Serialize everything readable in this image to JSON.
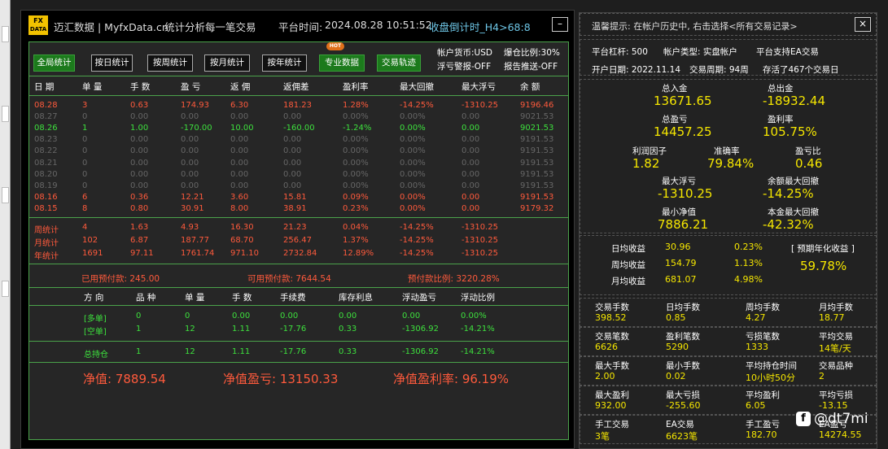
{
  "title": {
    "logo_top": "FX",
    "logo_bottom": "DATA",
    "brand": "迈汇数据 | MyfxData.cn",
    "subtitle": "统计分析每一笔交易",
    "time_label": "平台时间:",
    "time_value": "2024.08.28 10:51:52",
    "countdown": "收盘倒计时_H4>68:8",
    "minimize": "–"
  },
  "buttons": [
    "全局统计",
    "按日统计",
    "按周统计",
    "按月统计",
    "按年统计",
    "专业数据",
    "交易轨迹"
  ],
  "hot_badge": "HOT",
  "account_info": {
    "currency": "帐户货币:USD",
    "leverage_ratio": "爆仓比例:30%",
    "float_alert": "浮亏警报-OFF",
    "report_push": "报告推送-OFF"
  },
  "table_headers": [
    "日 期",
    "单 量",
    "手 数",
    "盈 亏",
    "返 佣",
    "返佣差",
    "盈利率",
    "最大回撤",
    "最大浮亏",
    "余 额"
  ],
  "daily_rows": [
    {
      "c": "red",
      "v": [
        "08.28",
        "3",
        "0.63",
        "174.93",
        "6.30",
        "181.23",
        "1.28%",
        "-14.25%",
        "-1310.25",
        "9196.46"
      ]
    },
    {
      "c": "gry",
      "v": [
        "08.27",
        "0",
        "0.00",
        "0.00",
        "0.00",
        "0.00",
        "0.00%",
        "0.00%",
        "0.00",
        "9021.53"
      ]
    },
    {
      "c": "grn",
      "v": [
        "08.26",
        "1",
        "1.00",
        "-170.00",
        "10.00",
        "-160.00",
        "-1.24%",
        "0.00%",
        "0.00",
        "9021.53"
      ]
    },
    {
      "c": "gry",
      "v": [
        "08.23",
        "0",
        "0.00",
        "0.00",
        "0.00",
        "0.00",
        "0.00%",
        "0.00%",
        "0.00",
        "9191.53"
      ]
    },
    {
      "c": "gry",
      "v": [
        "08.22",
        "0",
        "0.00",
        "0.00",
        "0.00",
        "0.00",
        "0.00%",
        "0.00%",
        "0.00",
        "9191.53"
      ]
    },
    {
      "c": "gry",
      "v": [
        "08.21",
        "0",
        "0.00",
        "0.00",
        "0.00",
        "0.00",
        "0.00%",
        "0.00%",
        "0.00",
        "9191.53"
      ]
    },
    {
      "c": "gry",
      "v": [
        "08.20",
        "0",
        "0.00",
        "0.00",
        "0.00",
        "0.00",
        "0.00%",
        "0.00%",
        "0.00",
        "9191.53"
      ]
    },
    {
      "c": "gry",
      "v": [
        "08.19",
        "0",
        "0.00",
        "0.00",
        "0.00",
        "0.00",
        "0.00%",
        "0.00%",
        "0.00",
        "9191.53"
      ]
    },
    {
      "c": "red",
      "v": [
        "08.16",
        "6",
        "0.36",
        "12.21",
        "3.60",
        "15.81",
        "0.09%",
        "0.00%",
        "0.00",
        "9191.53"
      ]
    },
    {
      "c": "red",
      "v": [
        "08.15",
        "8",
        "0.80",
        "30.91",
        "8.00",
        "38.91",
        "0.23%",
        "0.00%",
        "0.00",
        "9179.32"
      ]
    }
  ],
  "period_rows": [
    {
      "c": "red",
      "v": [
        "周统计",
        "4",
        "1.63",
        "4.93",
        "16.30",
        "21.23",
        "0.04%",
        "-14.25%",
        "-1310.25"
      ]
    },
    {
      "c": "red",
      "v": [
        "月统计",
        "102",
        "6.87",
        "187.77",
        "68.70",
        "256.47",
        "1.37%",
        "-14.25%",
        "-1310.25"
      ]
    },
    {
      "c": "red",
      "v": [
        "年统计",
        "1691",
        "97.11",
        "1761.74",
        "971.10",
        "2732.84",
        "12.89%",
        "-14.25%",
        "-1310.25"
      ]
    }
  ],
  "margin": {
    "used": "已用预付款:  245.00",
    "free": "可用预付款:  7644.54",
    "ratio": "预付款比例:  3220.28%"
  },
  "pos_headers": [
    "方 向",
    "品 种",
    "单 量",
    "手 数",
    "手续费",
    "库存利息",
    "浮动盈亏",
    "浮动比例"
  ],
  "pos_rows": [
    {
      "c": "grn",
      "v": [
        "[多单]",
        "0",
        "0",
        "0.00",
        "0.00",
        "0.00",
        "0.00",
        "0.00%"
      ]
    },
    {
      "c": "grn",
      "v": [
        "[空单]",
        "1",
        "12",
        "1.11",
        "-17.76",
        "0.33",
        "-1306.92",
        "-14.21%"
      ]
    }
  ],
  "total_row": {
    "c": "grn",
    "v": [
      "总持仓",
      "1",
      "12",
      "1.11",
      "-17.76",
      "0.33",
      "-1306.92",
      "-14.21%"
    ]
  },
  "equity": {
    "net": "净值:  7889.54",
    "net_pl": "净值盈亏:  13150.33",
    "net_rate": "净值盈利率:  96.19%"
  },
  "right": {
    "tip": "温馨提示: 在帐户历史中, 右击选择<所有交易记录>",
    "close": "×",
    "row1": [
      "平台杠杆:  500",
      "帐户类型:  实盘帐户",
      "平台支持EA交易"
    ],
    "row2": [
      "开户日期:  2022.11.14",
      "交易周期:  94周",
      "存活了467个交易日"
    ],
    "pairs": [
      {
        "l1": "总入金",
        "v1": "13671.65",
        "l2": "总出金",
        "v2": "-18932.44"
      },
      {
        "l1": "总盈亏",
        "v1": "14457.25",
        "l2": "盈利率",
        "v2": "105.75%"
      }
    ],
    "triple": {
      "labels": [
        "利润因子",
        "准确率",
        "盈亏比"
      ],
      "values": [
        "1.82",
        "79.84%",
        "0.46"
      ]
    },
    "pairs2": [
      {
        "l1": "最大浮亏",
        "v1": "-1310.25",
        "l2": "余额最大回撤",
        "v2": "-14.25%"
      },
      {
        "l1": "最小净值",
        "v1": "7886.21",
        "l2": "本金最大回撤",
        "v2": "-42.32%"
      }
    ],
    "avg": {
      "rows": [
        [
          "日均收益",
          "30.96",
          "0.23%"
        ],
        [
          "周均收益",
          "154.79",
          "1.13%"
        ],
        [
          "月均收益",
          "681.07",
          "4.98%"
        ]
      ],
      "forecast_label": "[ 预期年化收益 ]",
      "forecast_value": "59.78%"
    },
    "grid": [
      [
        [
          "交易手数",
          "398.52"
        ],
        [
          "日均手数",
          "0.85"
        ],
        [
          "周均手数",
          "4.27"
        ],
        [
          "月均手数",
          "18.77"
        ]
      ],
      [
        [
          "交易笔数",
          "6626"
        ],
        [
          "盈利笔数",
          "5290"
        ],
        [
          "亏损笔数",
          "1333"
        ],
        [
          "平均交易",
          "14笔/天"
        ]
      ],
      [
        [
          "最大手数",
          "2.00"
        ],
        [
          "最小手数",
          "0.02"
        ],
        [
          "平均持仓时间",
          "10小时50分"
        ],
        [
          "交易品种",
          "2"
        ]
      ],
      [
        [
          "最大盈利",
          "932.00"
        ],
        [
          "最大亏损",
          "-255.60"
        ],
        [
          "平均盈利",
          "6.05"
        ],
        [
          "平均亏损",
          "-13.15"
        ]
      ],
      [
        [
          "手工交易",
          "3笔"
        ],
        [
          "EA交易",
          "6623笔"
        ],
        [
          "手工盈亏",
          "182.70"
        ],
        [
          "EA盈亏",
          "14274.55"
        ]
      ]
    ]
  },
  "watermark": {
    "icon": "f",
    "text": "@dt7mi"
  },
  "colors": {
    "red": "#ff5a3c",
    "green": "#3de03d",
    "gray": "#666666",
    "yellow": "#f5e600",
    "border_green": "#4aa24a",
    "button_green": "#1c7a1c",
    "cyan": "#6ec6e6"
  }
}
